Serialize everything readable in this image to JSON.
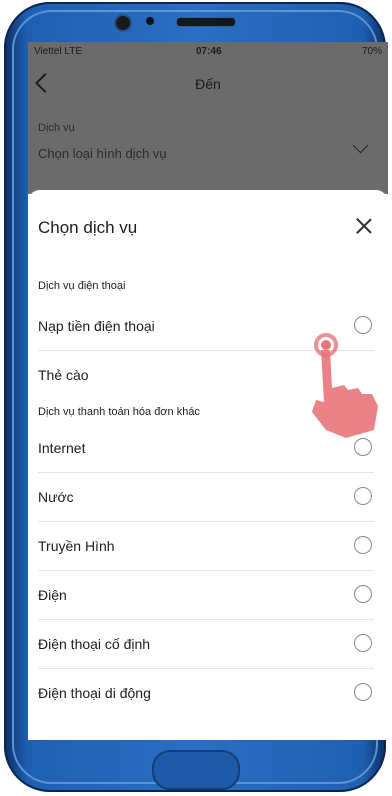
{
  "status_bar": {
    "carrier": "Viettel LTE",
    "time": "07:46",
    "battery": "70%"
  },
  "header": {
    "title": "Đến"
  },
  "service_field": {
    "label": "Dịch vụ",
    "value": "Chọn loại hình dịch vụ"
  },
  "sheet": {
    "title": "Chọn dịch vụ",
    "groups": [
      {
        "title": "Dịch vụ điện thoại",
        "items": [
          "Nạp tiền điện thoại",
          "Thẻ cào"
        ]
      },
      {
        "title": "Dịch vụ thanh toán hóa đơn khác",
        "items": [
          "Internet",
          "Nước",
          "Truyền Hình",
          "Điện",
          "Điện thoại cố định",
          "Điện thoại di động"
        ]
      }
    ]
  },
  "colors": {
    "phone_frame": "#2a6fc4",
    "overlay": "#6b6b6b",
    "hand": "#e8747a"
  },
  "icons": [
    "back-icon",
    "chevron-down-icon",
    "close-icon",
    "radio-icon",
    "tap-hand-icon"
  ]
}
